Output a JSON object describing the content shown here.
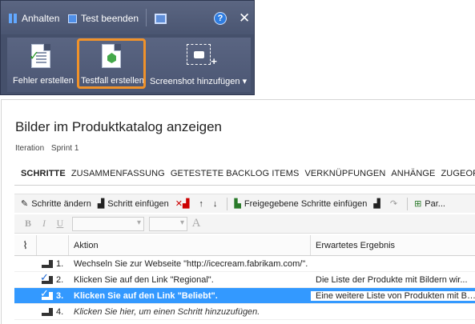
{
  "runner": {
    "pause_label": "Anhalten",
    "end_test_label": "Test beenden",
    "help_symbol": "?",
    "close_symbol": "✕",
    "commands": [
      {
        "label": "Fehler erstellen",
        "icon": "bug-document-icon"
      },
      {
        "label": "Testfall erstellen",
        "icon": "testcase-document-icon",
        "highlighted": true
      },
      {
        "label": "Screenshot hinzufügen",
        "icon": "screenshot-icon",
        "dropdown": true
      }
    ],
    "dropdown_symbol": "▾"
  },
  "workitem": {
    "title": "Bilder im Produktkatalog anzeigen",
    "iteration_label": "Iteration",
    "iteration_value": "Sprint 1",
    "tabs": [
      "SCHRITTE",
      "ZUSAMMENFASSUNG",
      "GETESTETE BACKLOG ITEMS",
      "VERKNÜPFUNGEN",
      "ANHÄNGE",
      "ZUGEORD..."
    ],
    "active_tab": "SCHRITTE",
    "toolbar": {
      "edit_steps": "Schritte ändern",
      "insert_step": "Schritt einfügen",
      "insert_shared_steps": "Freigegebene Schritte einfügen",
      "params": "Par..."
    },
    "format": {
      "bold": "B",
      "italic": "I",
      "underline": "U",
      "font_color": "A"
    },
    "grid": {
      "col_action": "Aktion",
      "col_expected": "Erwartetes Ergebnis",
      "rows": [
        {
          "num": "1.",
          "action": "Wechseln Sie zur Webseite \"http://icecream.fabrikam.com/\".",
          "expected": "",
          "passed": false
        },
        {
          "num": "2.",
          "action": "Klicken Sie auf den Link \"Regional\".",
          "expected": "Die Liste der Produkte mit Bildern wir...",
          "passed": true
        },
        {
          "num": "3.",
          "action": "Klicken Sie auf den Link \"Beliebt\".",
          "expected": "Eine weitere Liste von Produkten mit Bi...",
          "passed": true,
          "selected": true
        },
        {
          "num": "4.",
          "action": "Klicken Sie hier, um einen Schritt hinzuzufügen.",
          "expected": "",
          "passed": false,
          "placeholder": true
        }
      ]
    }
  },
  "colors": {
    "runner_bg": "#45506b",
    "highlight": "#f0922a",
    "selection": "#3399ff"
  }
}
